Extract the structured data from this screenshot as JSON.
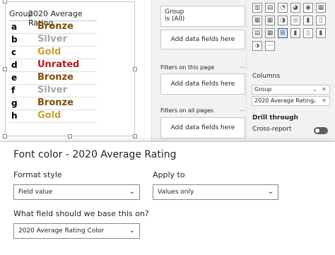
{
  "table": {
    "headers": {
      "group": "Group",
      "rating": "2020 Average Rating"
    },
    "rows": [
      {
        "group": "a",
        "rating": "Bronze",
        "color": "#7f4f06"
      },
      {
        "group": "b",
        "rating": "Silver",
        "color": "#a6a6a6"
      },
      {
        "group": "c",
        "rating": "Gold",
        "color": "#c9a227"
      },
      {
        "group": "d",
        "rating": "Unrated",
        "color": "#b01c1c"
      },
      {
        "group": "e",
        "rating": "Bronze",
        "color": "#7f4f06"
      },
      {
        "group": "f",
        "rating": "Silver",
        "color": "#a6a6a6"
      },
      {
        "group": "g",
        "rating": "Bronze",
        "color": "#7f4f06"
      },
      {
        "group": "h",
        "rating": "Gold",
        "color": "#c9a227"
      }
    ]
  },
  "filters": {
    "group_card": {
      "line1": "Group",
      "line2": "is (All)"
    },
    "add_fields": "Add data fields here",
    "page_section": "Filters on this page",
    "all_pages_section": "Filters on all pages",
    "more": "..."
  },
  "viz": {
    "columns_label": "Columns",
    "wells": [
      {
        "label": "Group"
      },
      {
        "label": "2020 Average Rating"
      }
    ],
    "drill_label": "Drill through",
    "cross_report": "Cross-report"
  },
  "dialog": {
    "title": "Font color - 2020 Average Rating",
    "format_style_label": "Format style",
    "format_style_value": "Field value",
    "apply_to_label": "Apply to",
    "apply_to_value": "Values only",
    "based_on_label": "What field should we base this on?",
    "based_on_value": "2020 Average Rating Color"
  }
}
